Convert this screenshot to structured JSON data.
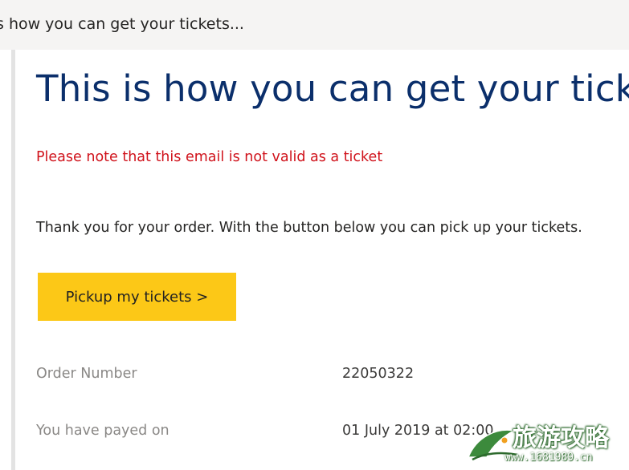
{
  "subject": {
    "text": "s how you can get your tickets..."
  },
  "email": {
    "heading": "This is how you can get your tickets",
    "warning": "Please note that this email is not valid as a ticket",
    "intro": "Thank you for your order. With the button below you can pick up your tickets.",
    "pickup_button_label": "Pickup my tickets >",
    "details": [
      {
        "label": "Order Number",
        "value": "22050322"
      },
      {
        "label": "You have payed on",
        "value": "01 July 2019 at 02:00"
      }
    ]
  },
  "watermark": {
    "cjk_text": "旅游攻略",
    "url_text": "www.1681989.cn"
  },
  "colors": {
    "heading": "#0b2f6b",
    "warning": "#d0121b",
    "button": "#fcc817",
    "subject_bar": "#f5f4f3",
    "label": "#8a8886"
  }
}
